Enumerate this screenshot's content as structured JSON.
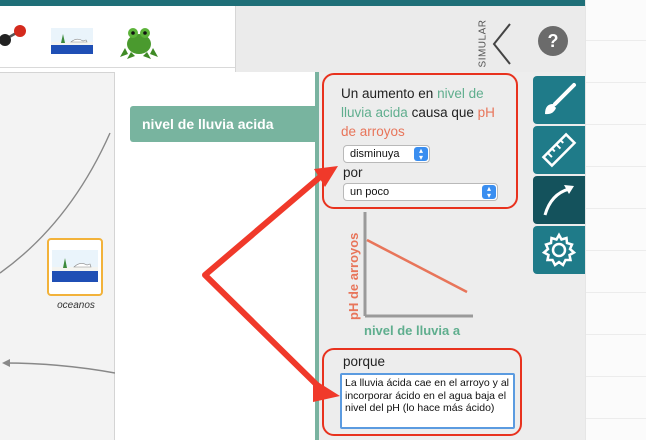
{
  "toolbar": {
    "simular_label": "SIMULAR",
    "help_label": "?"
  },
  "canvas": {
    "selected_node_title": "nivel de lluvia acida",
    "ocean_node_label": "oceanos"
  },
  "relationship": {
    "intro": "Un aumento en",
    "cause_variable": "nivel de lluvia acida",
    "causes_text": "causa que",
    "effect_variable": "pH de arroyos",
    "direction_value": "disminuya",
    "por_label": "por",
    "amount_value": "un poco",
    "graph": {
      "y_label": "pH de arroyos",
      "x_label": "nivel de lluvia a"
    },
    "porque_label": "porque",
    "porque_text": "La lluvia ácida cae en el arroyo y al incorporar ácido en el agua baja el nivel del pH (lo hace más ácido)"
  },
  "colors": {
    "teal_accent": "#1f7b89",
    "teal_dark": "#14525c",
    "cause_green": "#5fae8e",
    "effect_orange": "#e8755a",
    "annotation_red": "#e8321e",
    "node_highlight": "#f2b23a"
  },
  "icons": [
    "molecule-icon",
    "landscape-icon",
    "frog-icon",
    "chevron-left-icon",
    "help-icon",
    "brush-icon",
    "ruler-icon",
    "curve-arrow-icon",
    "gear-icon"
  ]
}
